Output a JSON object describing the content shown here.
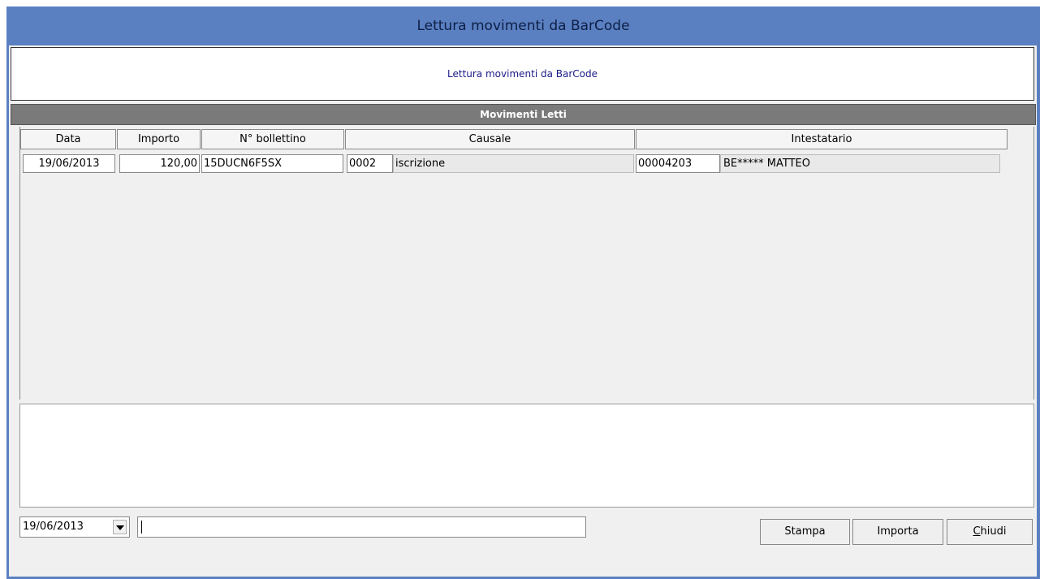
{
  "window": {
    "title": "Lettura movimenti da BarCode"
  },
  "header": {
    "text": "Lettura movimenti da BarCode"
  },
  "section": {
    "title": "Movimenti Letti"
  },
  "table": {
    "columns": [
      "Data",
      "Importo",
      "N° bollettino",
      "Causale",
      "Intestatario"
    ],
    "rows": [
      {
        "data": "19/06/2013",
        "importo": "120,00",
        "bollettino": "15DUCN6F5SX",
        "causale_code": "0002",
        "causale_desc": "iscrizione",
        "intestatario_code": "00004203",
        "intestatario_name": "BE***** MATTEO"
      }
    ]
  },
  "footer": {
    "date_value": "19/06/2013",
    "text_value": "",
    "buttons": {
      "stampa": "Stampa",
      "importa": "Importa",
      "chiudi_first": "C",
      "chiudi_rest": "hiudi"
    }
  },
  "icons": {
    "dropdown": "chevron-down-icon"
  },
  "colors": {
    "title_bar": "#5a80c1",
    "band": "#7a7a7a",
    "header_text": "#1a1a88"
  }
}
